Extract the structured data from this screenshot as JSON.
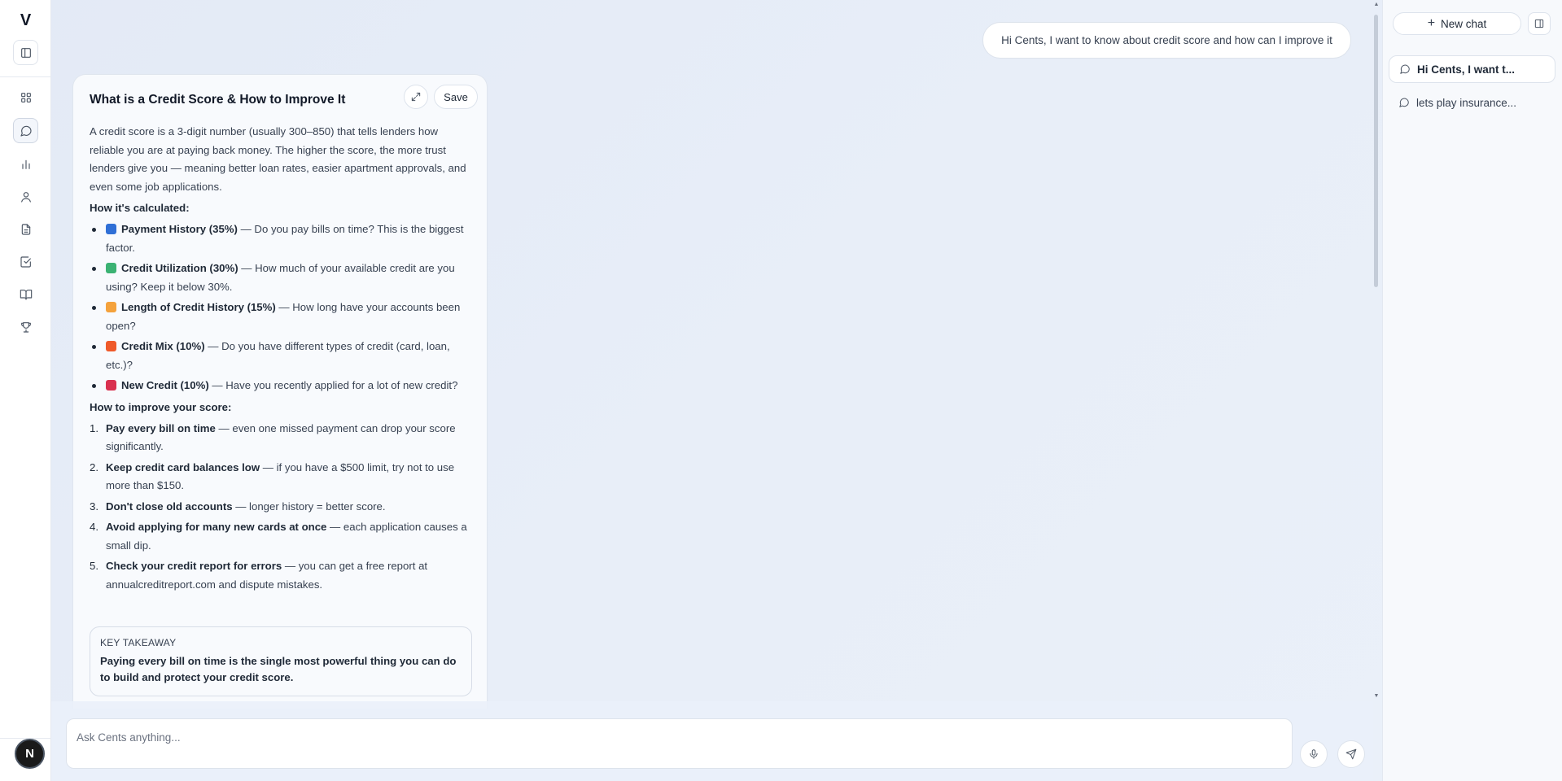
{
  "rail": {
    "logo": "V",
    "avatar_initial": "N"
  },
  "conversation": {
    "user_message": "Hi Cents, I want to know about credit score and how can I improve it"
  },
  "card": {
    "title": "What is a Credit Score & How to Improve It",
    "save_label": "Save",
    "intro": "A credit score is a 3-digit number (usually 300–850) that tells lenders how reliable you are at paying back money. The higher the score, the more trust lenders give you — meaning better loan rates, easier apartment approvals, and even some job applications.",
    "calc_heading": "How it's calculated:",
    "factors": [
      {
        "name": "Payment History (35%)",
        "desc": " — Do you pay bills on time? This is the biggest factor.",
        "color": "#2f6fd6"
      },
      {
        "name": "Credit Utilization (30%)",
        "desc": " — How much of your available credit are you using? Keep it below 30%.",
        "color": "#3bb273"
      },
      {
        "name": "Length of Credit History (15%)",
        "desc": " — How long have your accounts been open?",
        "color": "#f4a23c"
      },
      {
        "name": "Credit Mix (10%)",
        "desc": " — Do you have different types of credit (card, loan, etc.)?",
        "color": "#ef5a2a"
      },
      {
        "name": "New Credit (10%)",
        "desc": " — Have you recently applied for a lot of new credit?",
        "color": "#d9304f"
      }
    ],
    "improve_heading": "How to improve your score:",
    "steps": [
      {
        "num": "1.",
        "title": "Pay every bill on time",
        "desc": " — even one missed payment can drop your score significantly."
      },
      {
        "num": "2.",
        "title": "Keep credit card balances low",
        "desc": " — if you have a $500 limit, try not to use more than $150."
      },
      {
        "num": "3.",
        "title": "Don't close old accounts",
        "desc": " — longer history = better score."
      },
      {
        "num": "4.",
        "title": "Avoid applying for many new cards at once",
        "desc": " — each application causes a small dip."
      },
      {
        "num": "5.",
        "title": "Check your credit report for errors",
        "desc": " — you can get a free report at annualcreditreport.com and dispute mistakes."
      }
    ],
    "takeaway_label": "KEY TAKEAWAY",
    "takeaway_text": "Paying every bill on time is the single most powerful thing you can do to build and protect your credit score."
  },
  "composer": {
    "placeholder": "Ask Cents anything..."
  },
  "right_panel": {
    "new_chat_label": "New chat",
    "chats": [
      {
        "label": "Hi Cents, I want t...",
        "active": true
      },
      {
        "label": "lets play insurance...",
        "active": false
      }
    ]
  }
}
